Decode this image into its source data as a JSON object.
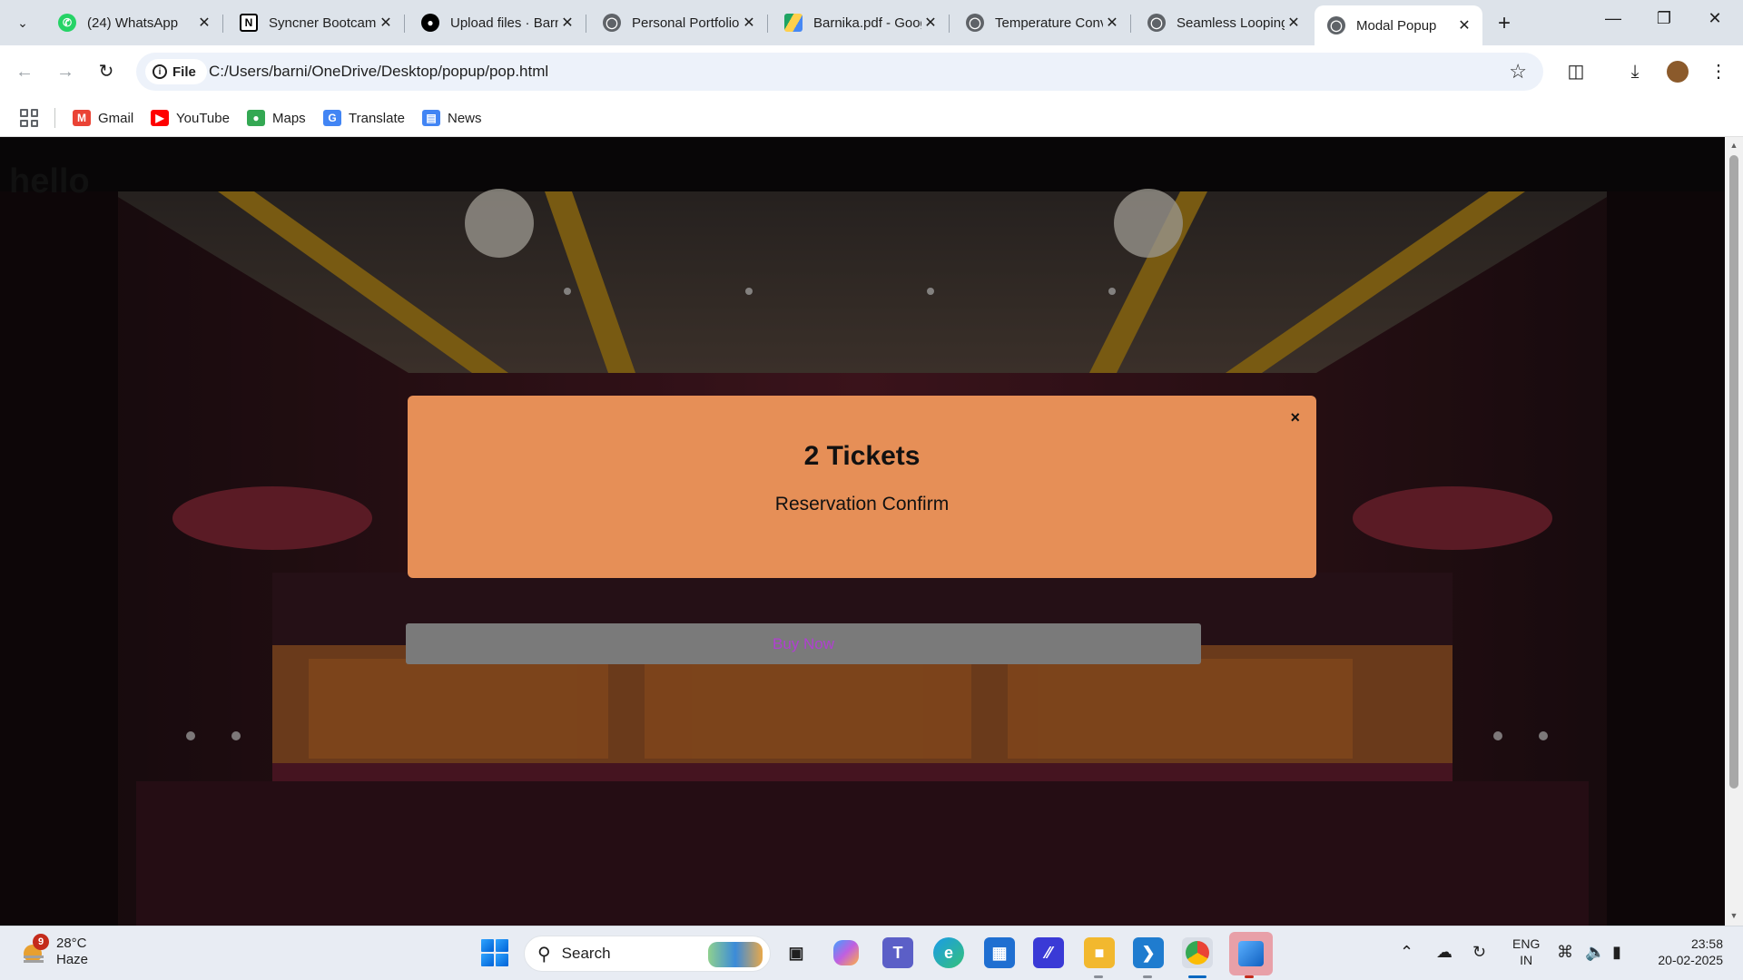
{
  "browser": {
    "tabs": [
      {
        "title": "(24) WhatsApp",
        "icon": "whatsapp-icon",
        "color": "#25d366"
      },
      {
        "title": "Syncner Bootcamp",
        "icon": "notion-icon",
        "color": "#000000"
      },
      {
        "title": "Upload files · Barnika",
        "icon": "github-icon",
        "color": "#000000"
      },
      {
        "title": "Personal Portfolio",
        "icon": "globe-icon",
        "color": "#5f6368"
      },
      {
        "title": "Barnika.pdf - Google Drive",
        "icon": "google-drive-icon",
        "color": "#1fa463"
      },
      {
        "title": "Temperature Converter",
        "icon": "globe-icon",
        "color": "#5f6368"
      },
      {
        "title": "Seamless Looping",
        "icon": "globe-icon",
        "color": "#5f6368"
      },
      {
        "title": "Modal Popup",
        "icon": "globe-icon",
        "color": "#5f6368",
        "active": true
      }
    ],
    "address": {
      "scheme_label": "File",
      "url": "C:/Users/barni/OneDrive/Desktop/popup/pop.html"
    },
    "bookmarks": [
      {
        "label": "Gmail",
        "icon": "gmail-icon",
        "color": "#ea4335"
      },
      {
        "label": "YouTube",
        "icon": "youtube-icon",
        "color": "#ff0000"
      },
      {
        "label": "Maps",
        "icon": "maps-icon",
        "color": "#34a853"
      },
      {
        "label": "Translate",
        "icon": "translate-icon",
        "color": "#4285f4"
      },
      {
        "label": "News",
        "icon": "news-icon",
        "color": "#4285f4"
      }
    ]
  },
  "page": {
    "heading": "hello",
    "modal": {
      "close_symbol": "×",
      "title": "2 Tickets",
      "message": "Reservation Confirm",
      "background": "#e68f57"
    },
    "buy_button": {
      "label": "Buy Now",
      "text_color": "#b040d0",
      "background": "#7a7a7a"
    }
  },
  "taskbar": {
    "weather": {
      "temp": "28°C",
      "condition": "Haze",
      "badge": "9"
    },
    "search_placeholder": "Search",
    "language": {
      "line1": "ENG",
      "line2": "IN"
    },
    "clock": {
      "time": "23:58",
      "date": "20-02-2025"
    }
  }
}
